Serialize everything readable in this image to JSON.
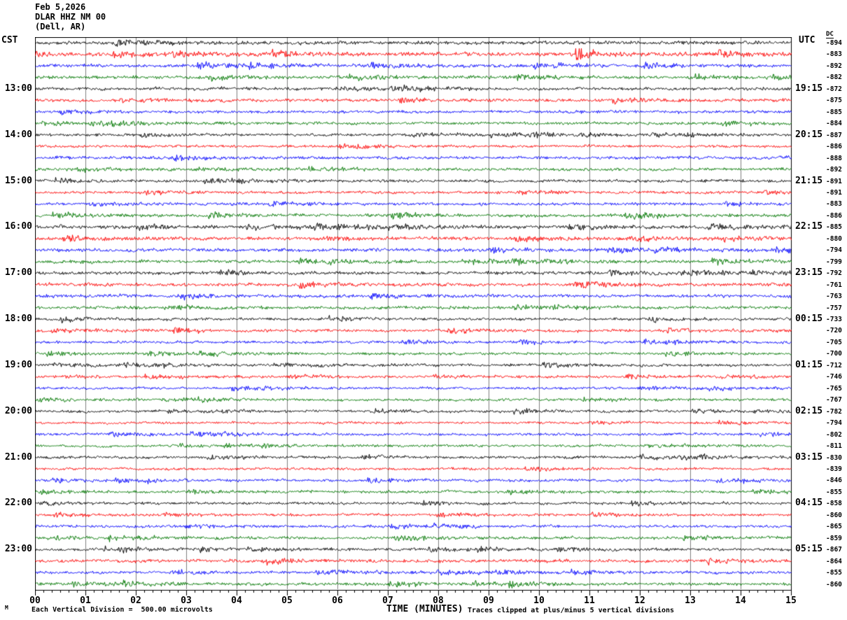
{
  "header": {
    "date": "Feb 5,2026",
    "station": "DLAR HHZ NM 00",
    "location": "(Dell, AR)"
  },
  "axes": {
    "left_label": "CST",
    "right_label": "UTC",
    "dc_label": "DC",
    "x_title": "TIME (MINUTES)"
  },
  "footer": {
    "scale_text": "Each Vertical Division =  500.00 microvolts",
    "clip_text": "Traces clipped at plus/minus 5 vertical divisions",
    "watermark": "M"
  },
  "chart_data": {
    "type": "line",
    "subtype": "helicorder-seismogram",
    "title": "DLAR HHZ NM 00 (Dell, AR) Feb 5,2026",
    "xlabel": "TIME (MINUTES)",
    "x_range": [
      0,
      15
    ],
    "x_tick_labels": [
      "00",
      "01",
      "02",
      "03",
      "04",
      "05",
      "06",
      "07",
      "08",
      "09",
      "10",
      "11",
      "12",
      "13",
      "14",
      "15"
    ],
    "minor_ticks_per_minute": 6,
    "grid": "vertical-gray-per-minute",
    "row_count": 48,
    "minutes_per_row": 15,
    "clip_divisions": 5,
    "microvolts_per_division": 500.0,
    "trace_color_cycle": [
      "black",
      "red",
      "blue",
      "green"
    ],
    "palette": {
      "black": "#000000",
      "red": "#fe0000",
      "blue": "#0000fe",
      "green": "#007700",
      "grid": "#808080",
      "border": "#000000"
    },
    "seed": 1337,
    "rows": [
      {
        "cst": "",
        "utc": "",
        "dc": -894,
        "color": "black",
        "amp": 2.0
      },
      {
        "cst": "",
        "utc": "",
        "dc": -883,
        "color": "red",
        "amp": 2.2
      },
      {
        "cst": "",
        "utc": "",
        "dc": -892,
        "color": "blue",
        "amp": 1.9
      },
      {
        "cst": "",
        "utc": "",
        "dc": -882,
        "color": "green",
        "amp": 1.8
      },
      {
        "cst": "13:00",
        "utc": "19:15",
        "dc": -872,
        "color": "black",
        "amp": 1.7
      },
      {
        "cst": "",
        "utc": "",
        "dc": -875,
        "color": "red",
        "amp": 1.7
      },
      {
        "cst": "",
        "utc": "",
        "dc": -885,
        "color": "blue",
        "amp": 1.6
      },
      {
        "cst": "",
        "utc": "",
        "dc": -884,
        "color": "green",
        "amp": 1.6
      },
      {
        "cst": "14:00",
        "utc": "20:15",
        "dc": -887,
        "color": "black",
        "amp": 1.5
      },
      {
        "cst": "",
        "utc": "",
        "dc": -886,
        "color": "red",
        "amp": 1.5
      },
      {
        "cst": "",
        "utc": "",
        "dc": -888,
        "color": "blue",
        "amp": 1.7
      },
      {
        "cst": "",
        "utc": "",
        "dc": -892,
        "color": "green",
        "amp": 1.6
      },
      {
        "cst": "15:00",
        "utc": "21:15",
        "dc": -891,
        "color": "black",
        "amp": 1.6
      },
      {
        "cst": "",
        "utc": "",
        "dc": -891,
        "color": "red",
        "amp": 1.5
      },
      {
        "cst": "",
        "utc": "",
        "dc": -883,
        "color": "blue",
        "amp": 1.6
      },
      {
        "cst": "",
        "utc": "",
        "dc": -886,
        "color": "green",
        "amp": 1.7
      },
      {
        "cst": "16:00",
        "utc": "22:15",
        "dc": -885,
        "color": "black",
        "amp": 1.9
      },
      {
        "cst": "",
        "utc": "",
        "dc": -880,
        "color": "red",
        "amp": 1.9
      },
      {
        "cst": "",
        "utc": "",
        "dc": -794,
        "color": "blue",
        "amp": 1.9
      },
      {
        "cst": "",
        "utc": "",
        "dc": -799,
        "color": "green",
        "amp": 1.8
      },
      {
        "cst": "17:00",
        "utc": "23:15",
        "dc": -792,
        "color": "black",
        "amp": 1.8
      },
      {
        "cst": "",
        "utc": "",
        "dc": -761,
        "color": "red",
        "amp": 1.9
      },
      {
        "cst": "",
        "utc": "",
        "dc": -763,
        "color": "blue",
        "amp": 1.8
      },
      {
        "cst": "",
        "utc": "",
        "dc": -757,
        "color": "green",
        "amp": 1.7
      },
      {
        "cst": "18:00",
        "utc": "00:15",
        "dc": -733,
        "color": "black",
        "amp": 1.5
      },
      {
        "cst": "",
        "utc": "",
        "dc": -720,
        "color": "red",
        "amp": 1.6
      },
      {
        "cst": "",
        "utc": "",
        "dc": -705,
        "color": "blue",
        "amp": 1.5
      },
      {
        "cst": "",
        "utc": "",
        "dc": -700,
        "color": "green",
        "amp": 1.5
      },
      {
        "cst": "19:00",
        "utc": "01:15",
        "dc": -712,
        "color": "black",
        "amp": 1.5
      },
      {
        "cst": "",
        "utc": "",
        "dc": -746,
        "color": "red",
        "amp": 1.4
      },
      {
        "cst": "",
        "utc": "",
        "dc": -765,
        "color": "blue",
        "amp": 1.4
      },
      {
        "cst": "",
        "utc": "",
        "dc": -767,
        "color": "green",
        "amp": 1.4
      },
      {
        "cst": "20:00",
        "utc": "02:15",
        "dc": -782,
        "color": "black",
        "amp": 1.4
      },
      {
        "cst": "",
        "utc": "",
        "dc": -794,
        "color": "red",
        "amp": 1.3
      },
      {
        "cst": "",
        "utc": "",
        "dc": -802,
        "color": "blue",
        "amp": 1.5
      },
      {
        "cst": "",
        "utc": "",
        "dc": -811,
        "color": "green",
        "amp": 1.4
      },
      {
        "cst": "21:00",
        "utc": "03:15",
        "dc": -830,
        "color": "black",
        "amp": 1.5
      },
      {
        "cst": "",
        "utc": "",
        "dc": -839,
        "color": "red",
        "amp": 1.4
      },
      {
        "cst": "",
        "utc": "",
        "dc": -846,
        "color": "blue",
        "amp": 1.4
      },
      {
        "cst": "",
        "utc": "",
        "dc": -855,
        "color": "green",
        "amp": 1.5
      },
      {
        "cst": "22:00",
        "utc": "04:15",
        "dc": -858,
        "color": "black",
        "amp": 1.4
      },
      {
        "cst": "",
        "utc": "",
        "dc": -860,
        "color": "red",
        "amp": 1.4
      },
      {
        "cst": "",
        "utc": "",
        "dc": -865,
        "color": "blue",
        "amp": 1.5
      },
      {
        "cst": "",
        "utc": "",
        "dc": -859,
        "color": "green",
        "amp": 1.6
      },
      {
        "cst": "23:00",
        "utc": "05:15",
        "dc": -867,
        "color": "black",
        "amp": 1.5
      },
      {
        "cst": "",
        "utc": "",
        "dc": -864,
        "color": "red",
        "amp": 1.8
      },
      {
        "cst": "",
        "utc": "",
        "dc": -855,
        "color": "blue",
        "amp": 1.6
      },
      {
        "cst": "",
        "utc": "",
        "dc": -860,
        "color": "green",
        "amp": 1.7
      }
    ],
    "events": [
      {
        "row": 1,
        "start_min": 10.72,
        "peak": 13.0,
        "decay1": 0.16,
        "coda": 3.0,
        "decay2": 1.4,
        "note": "strong burst on red trace ~min 10.8"
      },
      {
        "row": 2,
        "start_min": 10.76,
        "peak": 5.5,
        "decay1": 0.06,
        "coda": 1.2,
        "decay2": 0.25,
        "note": "small spike on blue trace ~min 10.8"
      },
      {
        "row": 1,
        "start_min": 0.0,
        "peak": 4.0,
        "decay1": 0.45,
        "coda": 0.0,
        "decay2": 1.0,
        "note": "elevated noise at left edge of red trace"
      }
    ]
  }
}
